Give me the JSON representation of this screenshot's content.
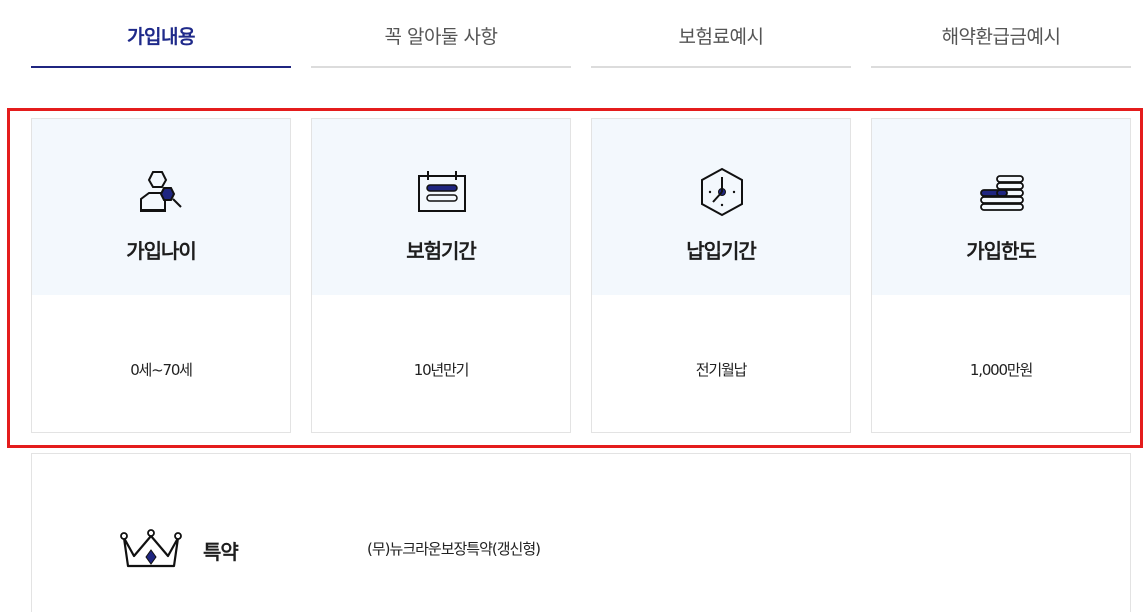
{
  "tabs": [
    {
      "label": "가입내용",
      "active": true
    },
    {
      "label": "꼭 알아둘 사항",
      "active": false
    },
    {
      "label": "보험료예시",
      "active": false
    },
    {
      "label": "해약환급금예시",
      "active": false
    }
  ],
  "cards": [
    {
      "icon": "user-hexagon-icon",
      "label": "가입나이",
      "value": "0세~70세"
    },
    {
      "icon": "calendar-icon",
      "label": "보험기간",
      "value": "10년만기"
    },
    {
      "icon": "clock-hexagon-icon",
      "label": "납입기간",
      "value": "전기월납"
    },
    {
      "icon": "coin-stack-icon",
      "label": "가입한도",
      "value": "1,000만원"
    }
  ],
  "rider": {
    "icon": "crown-icon",
    "title": "특약",
    "description": "(무)뉴크라운보장특약(갱신형)"
  },
  "colors": {
    "accent": "#1f2580",
    "card_head_bg": "#f3f8fd",
    "highlight": "#e41c1c"
  }
}
